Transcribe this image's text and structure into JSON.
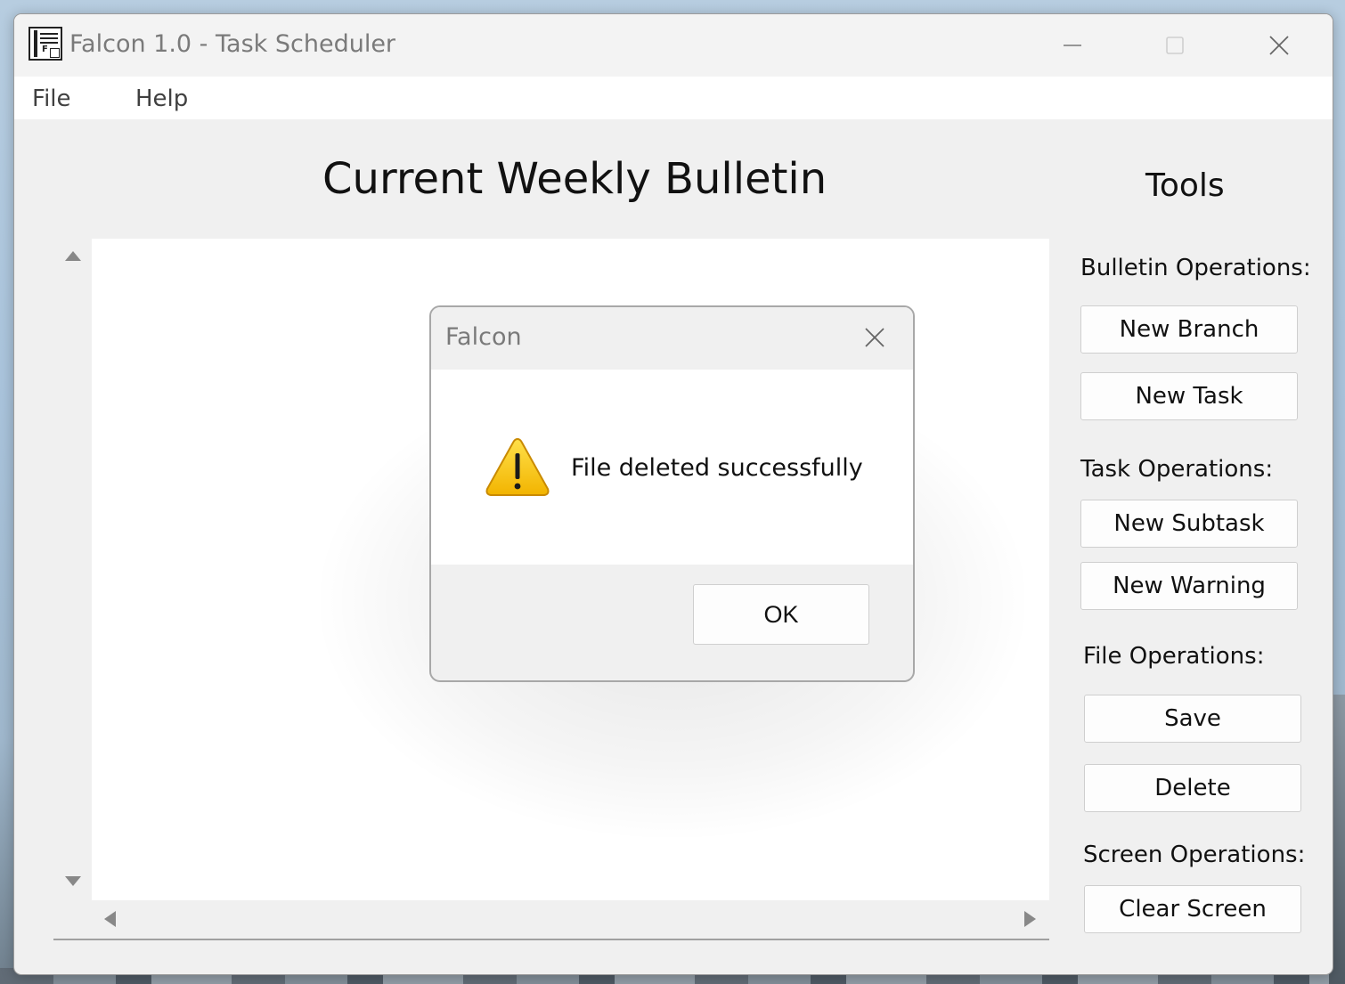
{
  "window": {
    "title": "Falcon 1.0 - Task Scheduler"
  },
  "menu": {
    "file": "File",
    "help": "Help"
  },
  "main": {
    "title": "Current Weekly Bulletin"
  },
  "tools": {
    "title": "Tools",
    "sections": {
      "bulletin": "Bulletin Operations:",
      "task": "Task Operations:",
      "file": "File Operations:",
      "screen": "Screen Operations:"
    },
    "buttons": {
      "new_branch": "New Branch",
      "new_task": "New Task",
      "new_subtask": "New Subtask",
      "new_warning": "New Warning",
      "save": "Save",
      "delete": "Delete",
      "clear_screen": "Clear Screen"
    }
  },
  "dialog": {
    "title": "Falcon",
    "message": "File deleted successfully",
    "ok_label": "OK",
    "icon": "warning-icon"
  },
  "colors": {
    "window_bg": "#f0f0f0",
    "title_text": "#7a7a7a",
    "warning_yellow": "#f7c400"
  }
}
